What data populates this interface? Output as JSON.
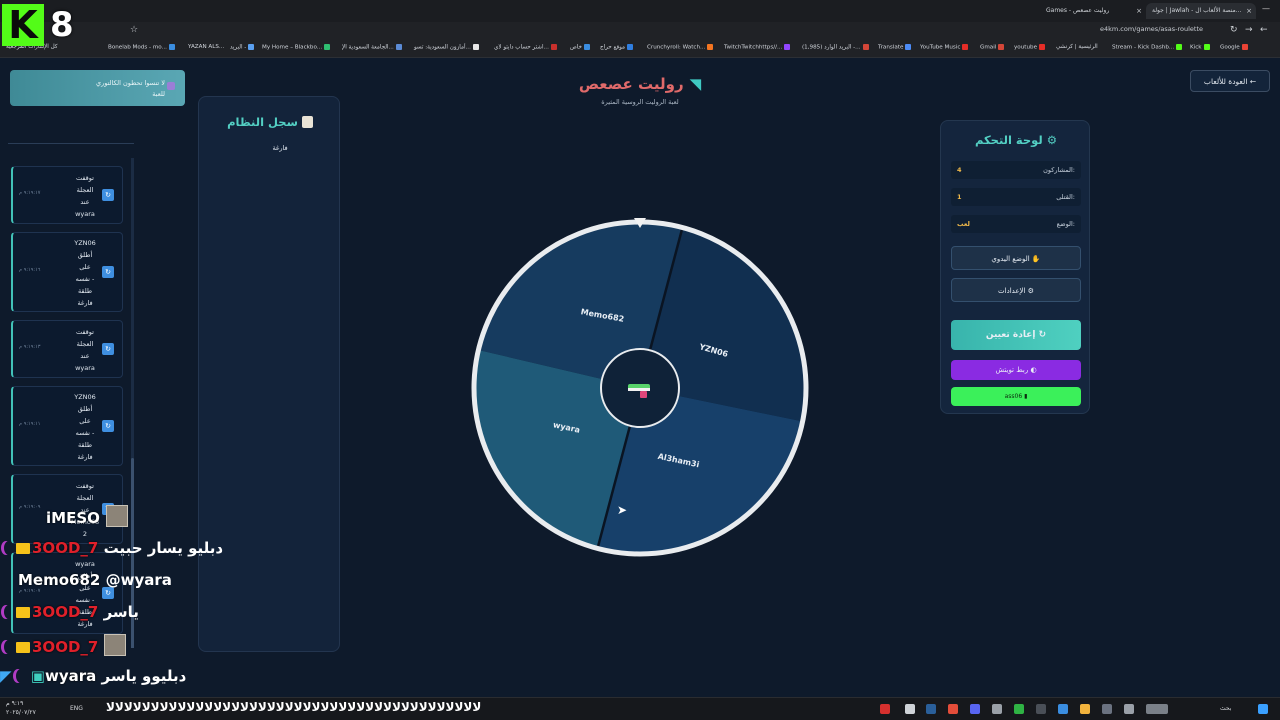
{
  "browser": {
    "tabs": [
      {
        "label": "جولة | Jawlah - منصة الألعاب ال...",
        "active": false
      },
      {
        "label": "Games - روليت عصعص",
        "active": true
      }
    ],
    "url": "e4km.com/games/asas-roulette",
    "bookmarks": [
      "كل الإشارات المرجعية",
      "Bonelab Mods - mo...",
      "YAZAN ALS...",
      "البريد -",
      "My Home – Blackbo...",
      "الجامعة السعودية الإ...",
      "أمازون السعودية: تسو...",
      "اشتر حساب دايتو لاي...",
      "خاص",
      "موقع حراج",
      "Crunchyroll: Watch...",
      "TwitchTwitchhttps//...",
      "(1,985) البريد الوارد -...",
      "Translate",
      "YouTube Music",
      "Gmail",
      "youtube",
      "الرئيسية | كرنشي",
      "Stream - Kick Dashb...",
      "Kick",
      "Google"
    ]
  },
  "overlay": {
    "logo_letter": "K",
    "logo_number": "8"
  },
  "page": {
    "toast_line1": "لا تنسوا تحطون الكالتوري",
    "toast_line2": "للعبة",
    "back_button": "العودة للألعاب ←",
    "title": "روليت عصعص",
    "subtitle": "لعبة الروليت الروسية المثيرة"
  },
  "log": {
    "title": "سجل النظام",
    "top_fragment": "فارغة",
    "entries": [
      {
        "lines": [
          "توقفت",
          "العجلة",
          "عند",
          "wyara"
        ],
        "time": "٩:١٩:١٧ م"
      },
      {
        "lines": [
          "YZN06",
          "أطلق",
          "على",
          "نفسه -",
          "طلقة",
          "فارغة"
        ],
        "time": "٩:١٩:١٦ م"
      },
      {
        "lines": [
          "توقفت",
          "العجلة",
          "عند",
          "wyara"
        ],
        "time": "٩:١٩:١٣ م"
      },
      {
        "lines": [
          "YZN06",
          "أطلق",
          "على",
          "نفسه -",
          "طلقة",
          "فارغة"
        ],
        "time": "٩:١٩:١١ م"
      },
      {
        "lines": [
          "توقفت",
          "العجلة",
          "عند",
          "Memo68",
          "2"
        ],
        "time": "٩:١٩:٠٩ م"
      },
      {
        "lines": [
          "wyara",
          "أطلق",
          "على",
          "نفسه -",
          "طلقة",
          "فارغة"
        ],
        "time": "٩:١٩:٠٧ م"
      }
    ]
  },
  "wheel": {
    "players": [
      "Memo682",
      "YZN06",
      "Al3ham3i",
      "wyara"
    ],
    "colors": {
      "Memo682": "#163b5f",
      "YZN06": "#112f50",
      "Al3ham3i": "#17406a",
      "wyara": "#1f5a78"
    }
  },
  "control": {
    "title": "لوحة التحكم",
    "stats": [
      {
        "label": "المشاركون:",
        "value": "4"
      },
      {
        "label": "القتلى:",
        "value": "1"
      },
      {
        "label": "الوضع:",
        "value": "لعب"
      }
    ],
    "manual_mode": "الوضع اليدوي",
    "settings": "الإعدادات",
    "reset": "إعادة تعيين",
    "twitch": "ربط تويتش",
    "kick": "ass06"
  },
  "chat": [
    {
      "user": "iMESO",
      "color": "#ffffff",
      "msg": "",
      "avatar": true
    },
    {
      "user": "3OOD_7",
      "color": "#e0202a",
      "msg": "دبليو يسار حبيت",
      "crown": true
    },
    {
      "user": "Memo682",
      "color": "#ffffff",
      "msg": "@wyara"
    },
    {
      "user": "3OOD_7",
      "color": "#e0202a",
      "msg": "ياسر",
      "crown": true
    },
    {
      "user": "3OOD_7",
      "color": "#e0202a",
      "msg": "",
      "crown": true,
      "avatar": true
    },
    {
      "user": "wyara",
      "color": "#ffffff",
      "msg": "دبليوو ياسر"
    }
  ],
  "taskbar": {
    "lang": "ENG",
    "time": "٩:١٩ م",
    "date": "٢٠٢٥/٠٧/٢٧",
    "search": "بحث",
    "spam": "ﻻﻻﻻﻻﻻﻻﻻﻻﻻﻻﻻﻻﻻﻻﻻﻻﻻﻻﻻﻻﻻﻻﻻﻻﻻﻻﻻﻻﻻﻻﻻﻻﻻﻻﻻﻻﻻﻻﻻﻻﻻﻻ"
  }
}
